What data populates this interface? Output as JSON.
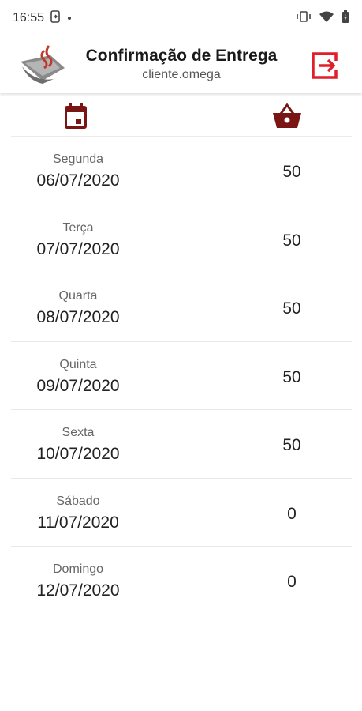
{
  "status_bar": {
    "time": "16:55"
  },
  "header": {
    "title": "Confirmação de Entrega",
    "subtitle": "cliente.omega"
  },
  "icons": {
    "logout": "logout-icon",
    "calendar": "calendar-icon",
    "basket": "basket-icon"
  },
  "colors": {
    "accent_red": "#e01f2a",
    "icon_dark_red": "#7a1515"
  },
  "days": [
    {
      "name": "Segunda",
      "date": "06/07/2020",
      "qty": "50"
    },
    {
      "name": "Terça",
      "date": "07/07/2020",
      "qty": "50"
    },
    {
      "name": "Quarta",
      "date": "08/07/2020",
      "qty": "50"
    },
    {
      "name": "Quinta",
      "date": "09/07/2020",
      "qty": "50"
    },
    {
      "name": "Sexta",
      "date": "10/07/2020",
      "qty": "50"
    },
    {
      "name": "Sábado",
      "date": "11/07/2020",
      "qty": "0"
    },
    {
      "name": "Domingo",
      "date": "12/07/2020",
      "qty": "0"
    }
  ]
}
